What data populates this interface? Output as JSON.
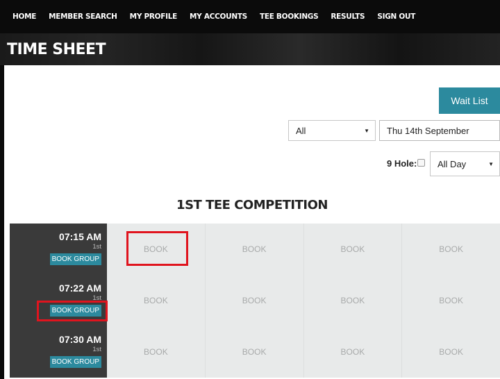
{
  "nav": {
    "items": [
      "HOME",
      "MEMBER SEARCH",
      "MY PROFILE",
      "MY ACCOUNTS",
      "TEE BOOKINGS",
      "RESULTS",
      "SIGN OUT"
    ]
  },
  "page": {
    "title": "TIME SHEET"
  },
  "filters": {
    "wait_list_label": "Wait List",
    "course_select": "All",
    "date_value": "Thu 14th September",
    "nine_hole_label": "9 Hole:",
    "nine_hole_checked": false,
    "time_select": "All Day"
  },
  "section": {
    "heading": "1ST TEE COMPETITION"
  },
  "tee_times": [
    {
      "time": "07:15 AM",
      "tee": "1st",
      "group_label": "BOOK GROUP",
      "slots": [
        "BOOK",
        "BOOK",
        "BOOK",
        "BOOK"
      ]
    },
    {
      "time": "07:22 AM",
      "tee": "1st",
      "group_label": "BOOK GROUP",
      "slots": [
        "BOOK",
        "BOOK",
        "BOOK",
        "BOOK"
      ]
    },
    {
      "time": "07:30 AM",
      "tee": "1st",
      "group_label": "BOOK GROUP",
      "slots": [
        "BOOK",
        "BOOK",
        "BOOK",
        "BOOK"
      ]
    }
  ],
  "colors": {
    "nav_bg": "#0b0b0b",
    "accent": "#2c8a9e",
    "time_cell_bg": "#3a3a3a",
    "slot_bg": "#e8eaea",
    "highlight": "#e0141e"
  },
  "icons": {
    "select_caret": "caret-down-icon"
  }
}
